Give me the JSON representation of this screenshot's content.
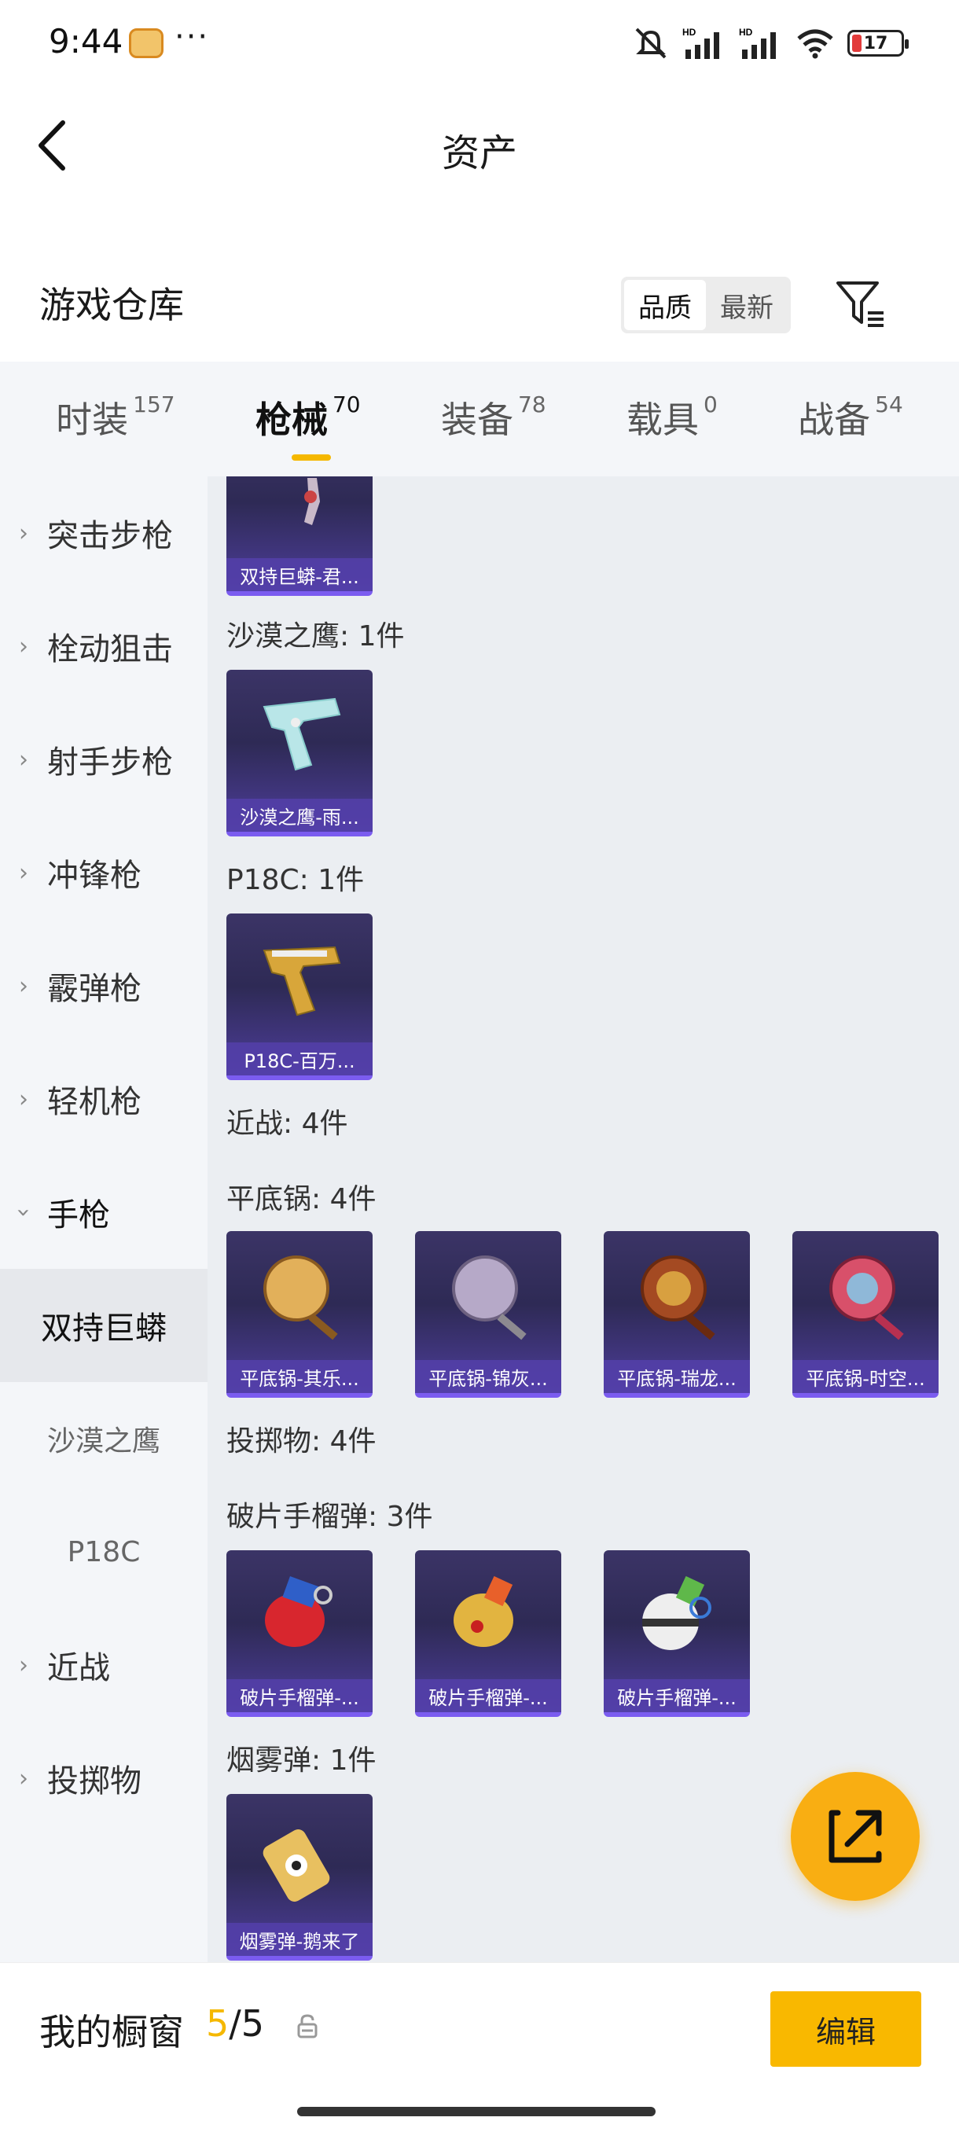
{
  "status_bar": {
    "time": "9:44",
    "more": "···",
    "network": "HD",
    "battery": "17"
  },
  "header": {
    "title": "资产"
  },
  "section": {
    "title": "游戏仓库"
  },
  "sort": {
    "options": [
      "品质",
      "最新"
    ],
    "active": "品质"
  },
  "tabs": [
    {
      "label": "时装",
      "count": "157"
    },
    {
      "label": "枪械",
      "count": "70",
      "active": true
    },
    {
      "label": "装备",
      "count": "78"
    },
    {
      "label": "载具",
      "count": "0"
    },
    {
      "label": "战备",
      "count": "54"
    }
  ],
  "left_nav": [
    {
      "label": "突击步枪",
      "type": "collapsed"
    },
    {
      "label": "栓动狙击",
      "type": "collapsed"
    },
    {
      "label": "射手步枪",
      "type": "collapsed"
    },
    {
      "label": "冲锋枪",
      "type": "collapsed"
    },
    {
      "label": "霰弹枪",
      "type": "collapsed"
    },
    {
      "label": "轻机枪",
      "type": "collapsed"
    },
    {
      "label": "手枪",
      "type": "expanded"
    },
    {
      "label": "双持巨蟒",
      "type": "selected"
    },
    {
      "label": "沙漠之鹰",
      "type": "sub"
    },
    {
      "label": "P18C",
      "type": "sub"
    },
    {
      "label": "近战",
      "type": "collapsed"
    },
    {
      "label": "投掷物",
      "type": "collapsed"
    }
  ],
  "content": {
    "top_card": {
      "name": "双持巨蟒-君..."
    },
    "groups": [
      {
        "label": "沙漠之鹰: 1件",
        "items": [
          "沙漠之鹰-雨..."
        ]
      },
      {
        "label": "P18C: 1件",
        "items": [
          "P18C-百万..."
        ]
      },
      {
        "label": "近战: 4件",
        "items": []
      },
      {
        "label": "平底锅: 4件",
        "items": [
          "平底锅-其乐...",
          "平底锅-锦灰...",
          "平底锅-瑞龙...",
          "平底锅-时空..."
        ]
      },
      {
        "label": "投掷物: 4件",
        "items": []
      },
      {
        "label": "破片手榴弹: 3件",
        "items": [
          "破片手榴弹-...",
          "破片手榴弹-...",
          "破片手榴弹-..."
        ]
      },
      {
        "label": "烟雾弹: 1件",
        "items": [
          "烟雾弹-鹅来了"
        ]
      }
    ]
  },
  "bottom_bar": {
    "title": "我的橱窗",
    "count_current": "5",
    "count_sep": "/",
    "count_total": "5",
    "edit_label": "编辑"
  },
  "colors": {
    "accent": "#f9b800",
    "card_bg": "#2e2a55",
    "card_stripe": "#7b5cf0"
  }
}
